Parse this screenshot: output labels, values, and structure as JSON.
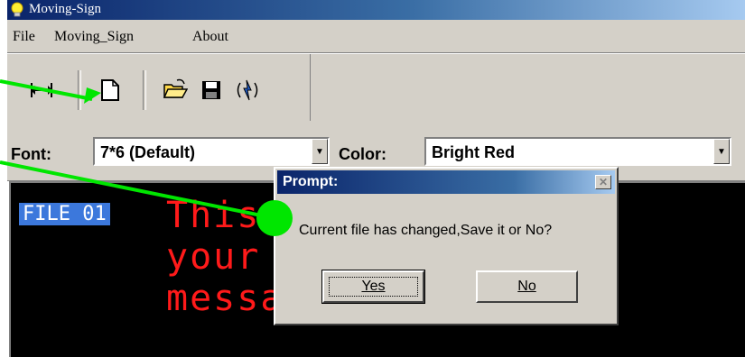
{
  "window": {
    "title": "Moving-Sign",
    "icon": "lightbulb-icon"
  },
  "menu": {
    "items": [
      "File",
      "Moving_Sign",
      "About"
    ]
  },
  "toolbar": {
    "buttons": [
      "move-text-icon",
      "new-file-icon",
      "open-folder-icon",
      "save-disk-icon",
      "send-sign-icon"
    ]
  },
  "options": {
    "font_label": "Font:",
    "font_value": "7*6 (Default)",
    "color_label": "Color:",
    "color_value": "Bright Red"
  },
  "display": {
    "file_tag": "FILE 01",
    "lines": [
      "This",
      "your",
      "messa"
    ],
    "text_color": "#ff1a1a"
  },
  "dialog": {
    "title": "Prompt:",
    "message": "Current file has changed,Save it or No?",
    "yes_label": "Yes",
    "no_label": "No"
  },
  "annotation": {
    "color": "#00e600"
  }
}
